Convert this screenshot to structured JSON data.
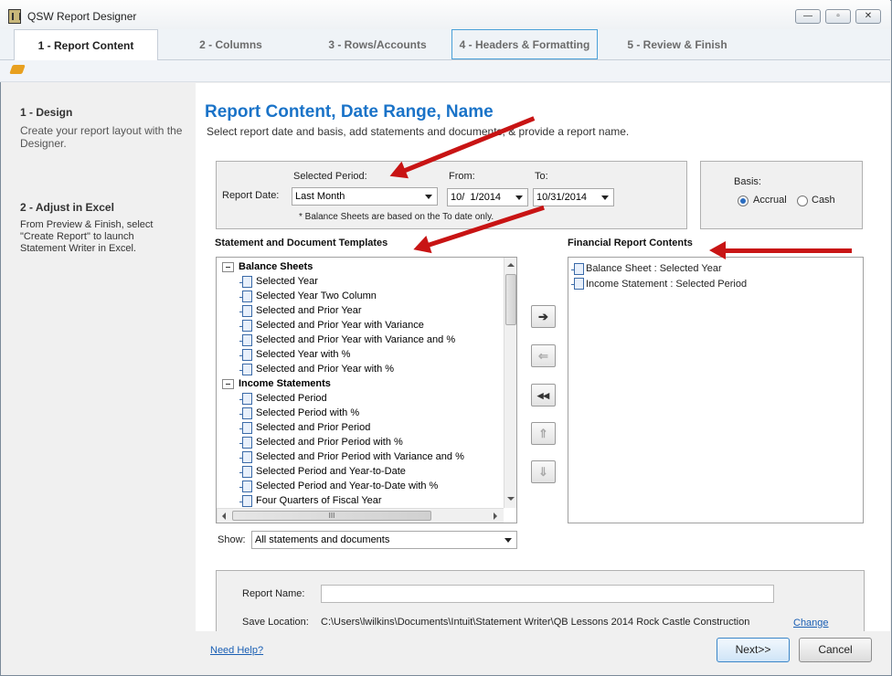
{
  "window": {
    "title": "QSW Report Designer"
  },
  "tabs": [
    {
      "label": "1 - Report Content"
    },
    {
      "label": "2 - Columns"
    },
    {
      "label": "3 - Rows/Accounts"
    },
    {
      "label": "4 - Headers & Formatting"
    },
    {
      "label": "5 - Review & Finish"
    }
  ],
  "sidebar": {
    "design_heading": "1 - Design",
    "design_text": "Create your report layout with the Designer.",
    "excel_heading": "2 - Adjust in Excel",
    "excel_text": "From Preview & Finish, select \"Create Report\" to launch Statement Writer in Excel."
  },
  "main": {
    "title": "Report Content, Date Range,  Name",
    "subtitle": "Select report date and basis, add statements and documents, & provide a report name."
  },
  "date_box": {
    "selected_period_label": "Selected Period:",
    "report_date_label": "Report Date:",
    "period_value": "Last Month",
    "from_label": "From:",
    "from_value": "10/  1/2014",
    "to_label": "To:",
    "to_value": "10/31/2014",
    "note": "* Balance Sheets are based on the To date only."
  },
  "basis": {
    "label": "Basis:",
    "accrual": "Accrual",
    "cash": "Cash",
    "selected": "Accrual"
  },
  "templates": {
    "heading": "Statement and Document Templates",
    "groups": [
      {
        "name": "Balance Sheets",
        "items": [
          "Selected Year",
          "Selected Year Two Column",
          "Selected and Prior Year",
          "Selected and Prior Year with Variance",
          "Selected and Prior Year with Variance and %",
          "Selected Year with %",
          "Selected and Prior Year with %"
        ]
      },
      {
        "name": "Income Statements",
        "items": [
          "Selected Period",
          "Selected Period with %",
          "Selected and Prior Period",
          "Selected and Prior Period with %",
          "Selected and Prior Period with Variance and %",
          "Selected Period and Year-to-Date",
          "Selected Period and Year-to-Date with %",
          "Four Quarters of Fiscal Year"
        ]
      }
    ],
    "hscroll_grip": "III",
    "show_label": "Show:",
    "show_value": "All statements and documents"
  },
  "contents": {
    "heading": "Financial Report Contents",
    "items": [
      "Balance Sheet : Selected Year",
      "Income Statement : Selected Period"
    ]
  },
  "move_buttons": [
    {
      "name": "add-button",
      "glyph": "➔",
      "enabled": true
    },
    {
      "name": "remove-button",
      "glyph": "⇐",
      "enabled": false
    },
    {
      "name": "remove-all-button",
      "glyph": "◂◂",
      "enabled": true
    },
    {
      "name": "move-up-button",
      "glyph": "⇑",
      "enabled": false
    },
    {
      "name": "move-down-button",
      "glyph": "⇓",
      "enabled": false
    }
  ],
  "report_name": {
    "label": "Report Name:",
    "value": "",
    "save_label": "Save Location:",
    "save_path": "C:\\Users\\lwilkins\\Documents\\Intuit\\Statement Writer\\QB Lessons 2014 Rock Castle Construction",
    "change_link": "Change"
  },
  "footer": {
    "help_link": "Need Help?",
    "next": "Next>>",
    "cancel": "Cancel"
  },
  "colors": {
    "accent": "#1a73c8",
    "annotation_arrow": "#c81414"
  }
}
